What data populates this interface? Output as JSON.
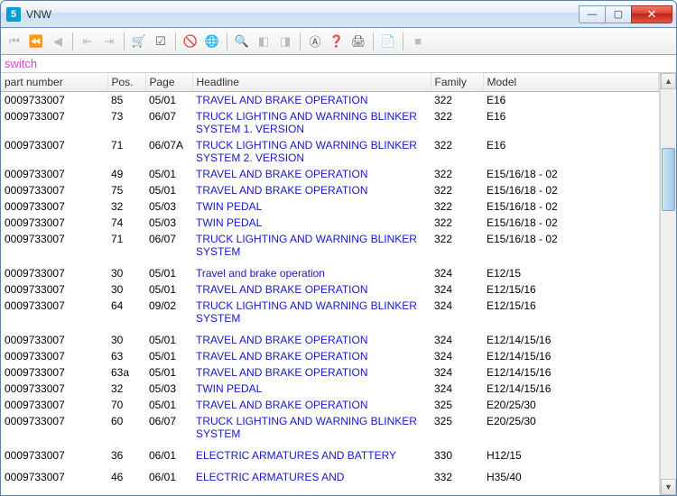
{
  "window": {
    "title": "VNW"
  },
  "search_label": "switch",
  "columns": {
    "part_number": "part number",
    "pos": "Pos.",
    "page": "Page",
    "headline": "Headline",
    "family": "Family",
    "model": "Model"
  },
  "col_widths": {
    "part_number": "118px",
    "pos": "42px",
    "page": "52px",
    "headline": "264px",
    "family": "58px",
    "model": "auto"
  },
  "toolbar": [
    {
      "name": "first-icon",
      "glyph": "⏮",
      "disabled": true
    },
    {
      "name": "prev-page-icon",
      "glyph": "⏪",
      "disabled": true
    },
    {
      "name": "prev-icon",
      "glyph": "◀",
      "disabled": true
    },
    {
      "sep": true
    },
    {
      "name": "jump-start-icon",
      "glyph": "⇤",
      "disabled": true
    },
    {
      "name": "jump-end-icon",
      "glyph": "⇥",
      "disabled": true
    },
    {
      "sep": true
    },
    {
      "name": "cart-icon",
      "glyph": "🛒",
      "disabled": false
    },
    {
      "name": "checklist-icon",
      "glyph": "☑",
      "disabled": false
    },
    {
      "sep": true
    },
    {
      "name": "unflag-icon",
      "glyph": "🚫",
      "disabled": false
    },
    {
      "name": "globe-icon",
      "glyph": "🌐",
      "disabled": false
    },
    {
      "sep": true
    },
    {
      "name": "zoom-icon",
      "glyph": "🔍",
      "disabled": true
    },
    {
      "name": "slide-prev-icon",
      "glyph": "◧",
      "disabled": true
    },
    {
      "name": "slide-next-icon",
      "glyph": "◨",
      "disabled": true
    },
    {
      "sep": true
    },
    {
      "name": "annotation-icon",
      "glyph": "Ⓐ",
      "disabled": false
    },
    {
      "name": "help-icon",
      "glyph": "❓",
      "disabled": false
    },
    {
      "name": "print-icon",
      "glyph": "🖨",
      "disabled": false
    },
    {
      "sep": true
    },
    {
      "name": "notes-icon",
      "glyph": "📄",
      "disabled": true
    },
    {
      "sep": true
    },
    {
      "name": "stop-icon",
      "glyph": "■",
      "disabled": true
    }
  ],
  "rows": [
    {
      "pn": "0009733007",
      "pos": "85",
      "page": "05/01",
      "headline": "TRAVEL AND BRAKE OPERATION",
      "family": "322",
      "model": "E16"
    },
    {
      "pn": "0009733007",
      "pos": "73",
      "page": "06/07",
      "headline": "TRUCK LIGHTING AND WARNING BLINKER SYSTEM 1. VERSION",
      "family": "322",
      "model": "E16"
    },
    {
      "pn": "0009733007",
      "pos": "71",
      "page": "06/07A",
      "headline": "TRUCK LIGHTING AND WARNING BLINKER SYSTEM 2. VERSION",
      "family": "322",
      "model": "E16"
    },
    {
      "pn": "0009733007",
      "pos": "49",
      "page": "05/01",
      "headline": "TRAVEL AND BRAKE OPERATION",
      "family": "322",
      "model": "E15/16/18 - 02"
    },
    {
      "pn": "0009733007",
      "pos": "75",
      "page": "05/01",
      "headline": "TRAVEL AND BRAKE OPERATION",
      "family": "322",
      "model": "E15/16/18 - 02"
    },
    {
      "pn": "0009733007",
      "pos": "32",
      "page": "05/03",
      "headline": "TWIN PEDAL",
      "family": "322",
      "model": "E15/16/18 - 02"
    },
    {
      "pn": "0009733007",
      "pos": "74",
      "page": "05/03",
      "headline": "TWIN PEDAL",
      "family": "322",
      "model": "E15/16/18 - 02"
    },
    {
      "pn": "0009733007",
      "pos": "71",
      "page": "06/07",
      "headline": "TRUCK LIGHTING AND WARNING BLINKER SYSTEM",
      "family": "322",
      "model": "E15/16/18 - 02"
    },
    {
      "gap": true
    },
    {
      "pn": "0009733007",
      "pos": "30",
      "page": "05/01",
      "headline": "Travel and brake operation",
      "family": "324",
      "model": "E12/15"
    },
    {
      "pn": "0009733007",
      "pos": "30",
      "page": "05/01",
      "headline": "TRAVEL AND BRAKE OPERATION",
      "family": "324",
      "model": "E12/15/16"
    },
    {
      "pn": "0009733007",
      "pos": "64",
      "page": "09/02",
      "headline": "TRUCK LIGHTING AND WARNING BLINKER SYSTEM",
      "family": "324",
      "model": "E12/15/16"
    },
    {
      "gap": true
    },
    {
      "pn": "0009733007",
      "pos": "30",
      "page": "05/01",
      "headline": "TRAVEL AND BRAKE OPERATION",
      "family": "324",
      "model": "E12/14/15/16"
    },
    {
      "pn": "0009733007",
      "pos": "63",
      "page": "05/01",
      "headline": "TRAVEL AND BRAKE OPERATION",
      "family": "324",
      "model": "E12/14/15/16"
    },
    {
      "pn": "0009733007",
      "pos": "63a",
      "page": "05/01",
      "headline": "TRAVEL AND BRAKE OPERATION",
      "family": "324",
      "model": "E12/14/15/16"
    },
    {
      "pn": "0009733007",
      "pos": "32",
      "page": "05/03",
      "headline": "TWIN PEDAL",
      "family": "324",
      "model": "E12/14/15/16"
    },
    {
      "pn": "0009733007",
      "pos": "70",
      "page": "05/01",
      "headline": "TRAVEL AND BRAKE OPERATION",
      "family": "325",
      "model": "E20/25/30"
    },
    {
      "pn": "0009733007",
      "pos": "60",
      "page": "06/07",
      "headline": "TRUCK LIGHTING AND WARNING BLINKER SYSTEM",
      "family": "325",
      "model": "E20/25/30"
    },
    {
      "gap": true
    },
    {
      "pn": "0009733007",
      "pos": "36",
      "page": "06/01",
      "headline": "ELECTRIC ARMATURES AND BATTERY",
      "family": "330",
      "model": "H12/15"
    },
    {
      "gap": true
    },
    {
      "pn": "0009733007",
      "pos": "46",
      "page": "06/01",
      "headline": "ELECTRIC ARMATURES AND",
      "family": "332",
      "model": "H35/40"
    }
  ]
}
